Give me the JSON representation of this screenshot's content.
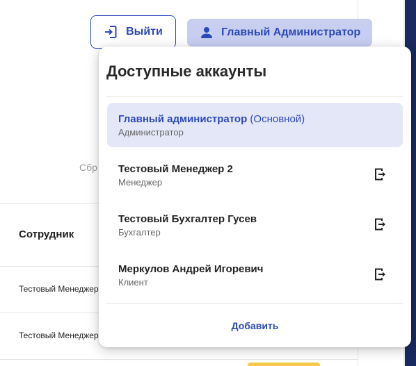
{
  "header": {
    "logout_label": "Выйти",
    "user_label": "Главный Администратор"
  },
  "background": {
    "reset_partial": "Сбр",
    "column_header": "Сотрудник",
    "rows": [
      "Тестовый Менеджер",
      "Тестовый Менеджер"
    ]
  },
  "accounts_menu": {
    "title": "Доступные аккаунты",
    "accounts": [
      {
        "name": "Главный администратор",
        "primary_tag": "(Основной)",
        "role": "Администратор",
        "active": true
      },
      {
        "name": "Тестовый Менеджер 2",
        "role": "Менеджер",
        "active": false
      },
      {
        "name": "Тестовый Бухгалтер Гусев",
        "role": "Бухгалтер",
        "active": false
      },
      {
        "name": "Меркулов Андрей Игоревич",
        "role": "Клиент",
        "active": false
      }
    ],
    "add_label": "Добавить"
  },
  "colors": {
    "accent": "#2c49b8",
    "user_button_bg": "#c7cef0",
    "active_row_bg": "#e4e7f7",
    "side_strip": "#182a5e"
  },
  "icons": {
    "logout": "logout-icon",
    "user": "user-icon",
    "switch_out": "exit-icon"
  }
}
